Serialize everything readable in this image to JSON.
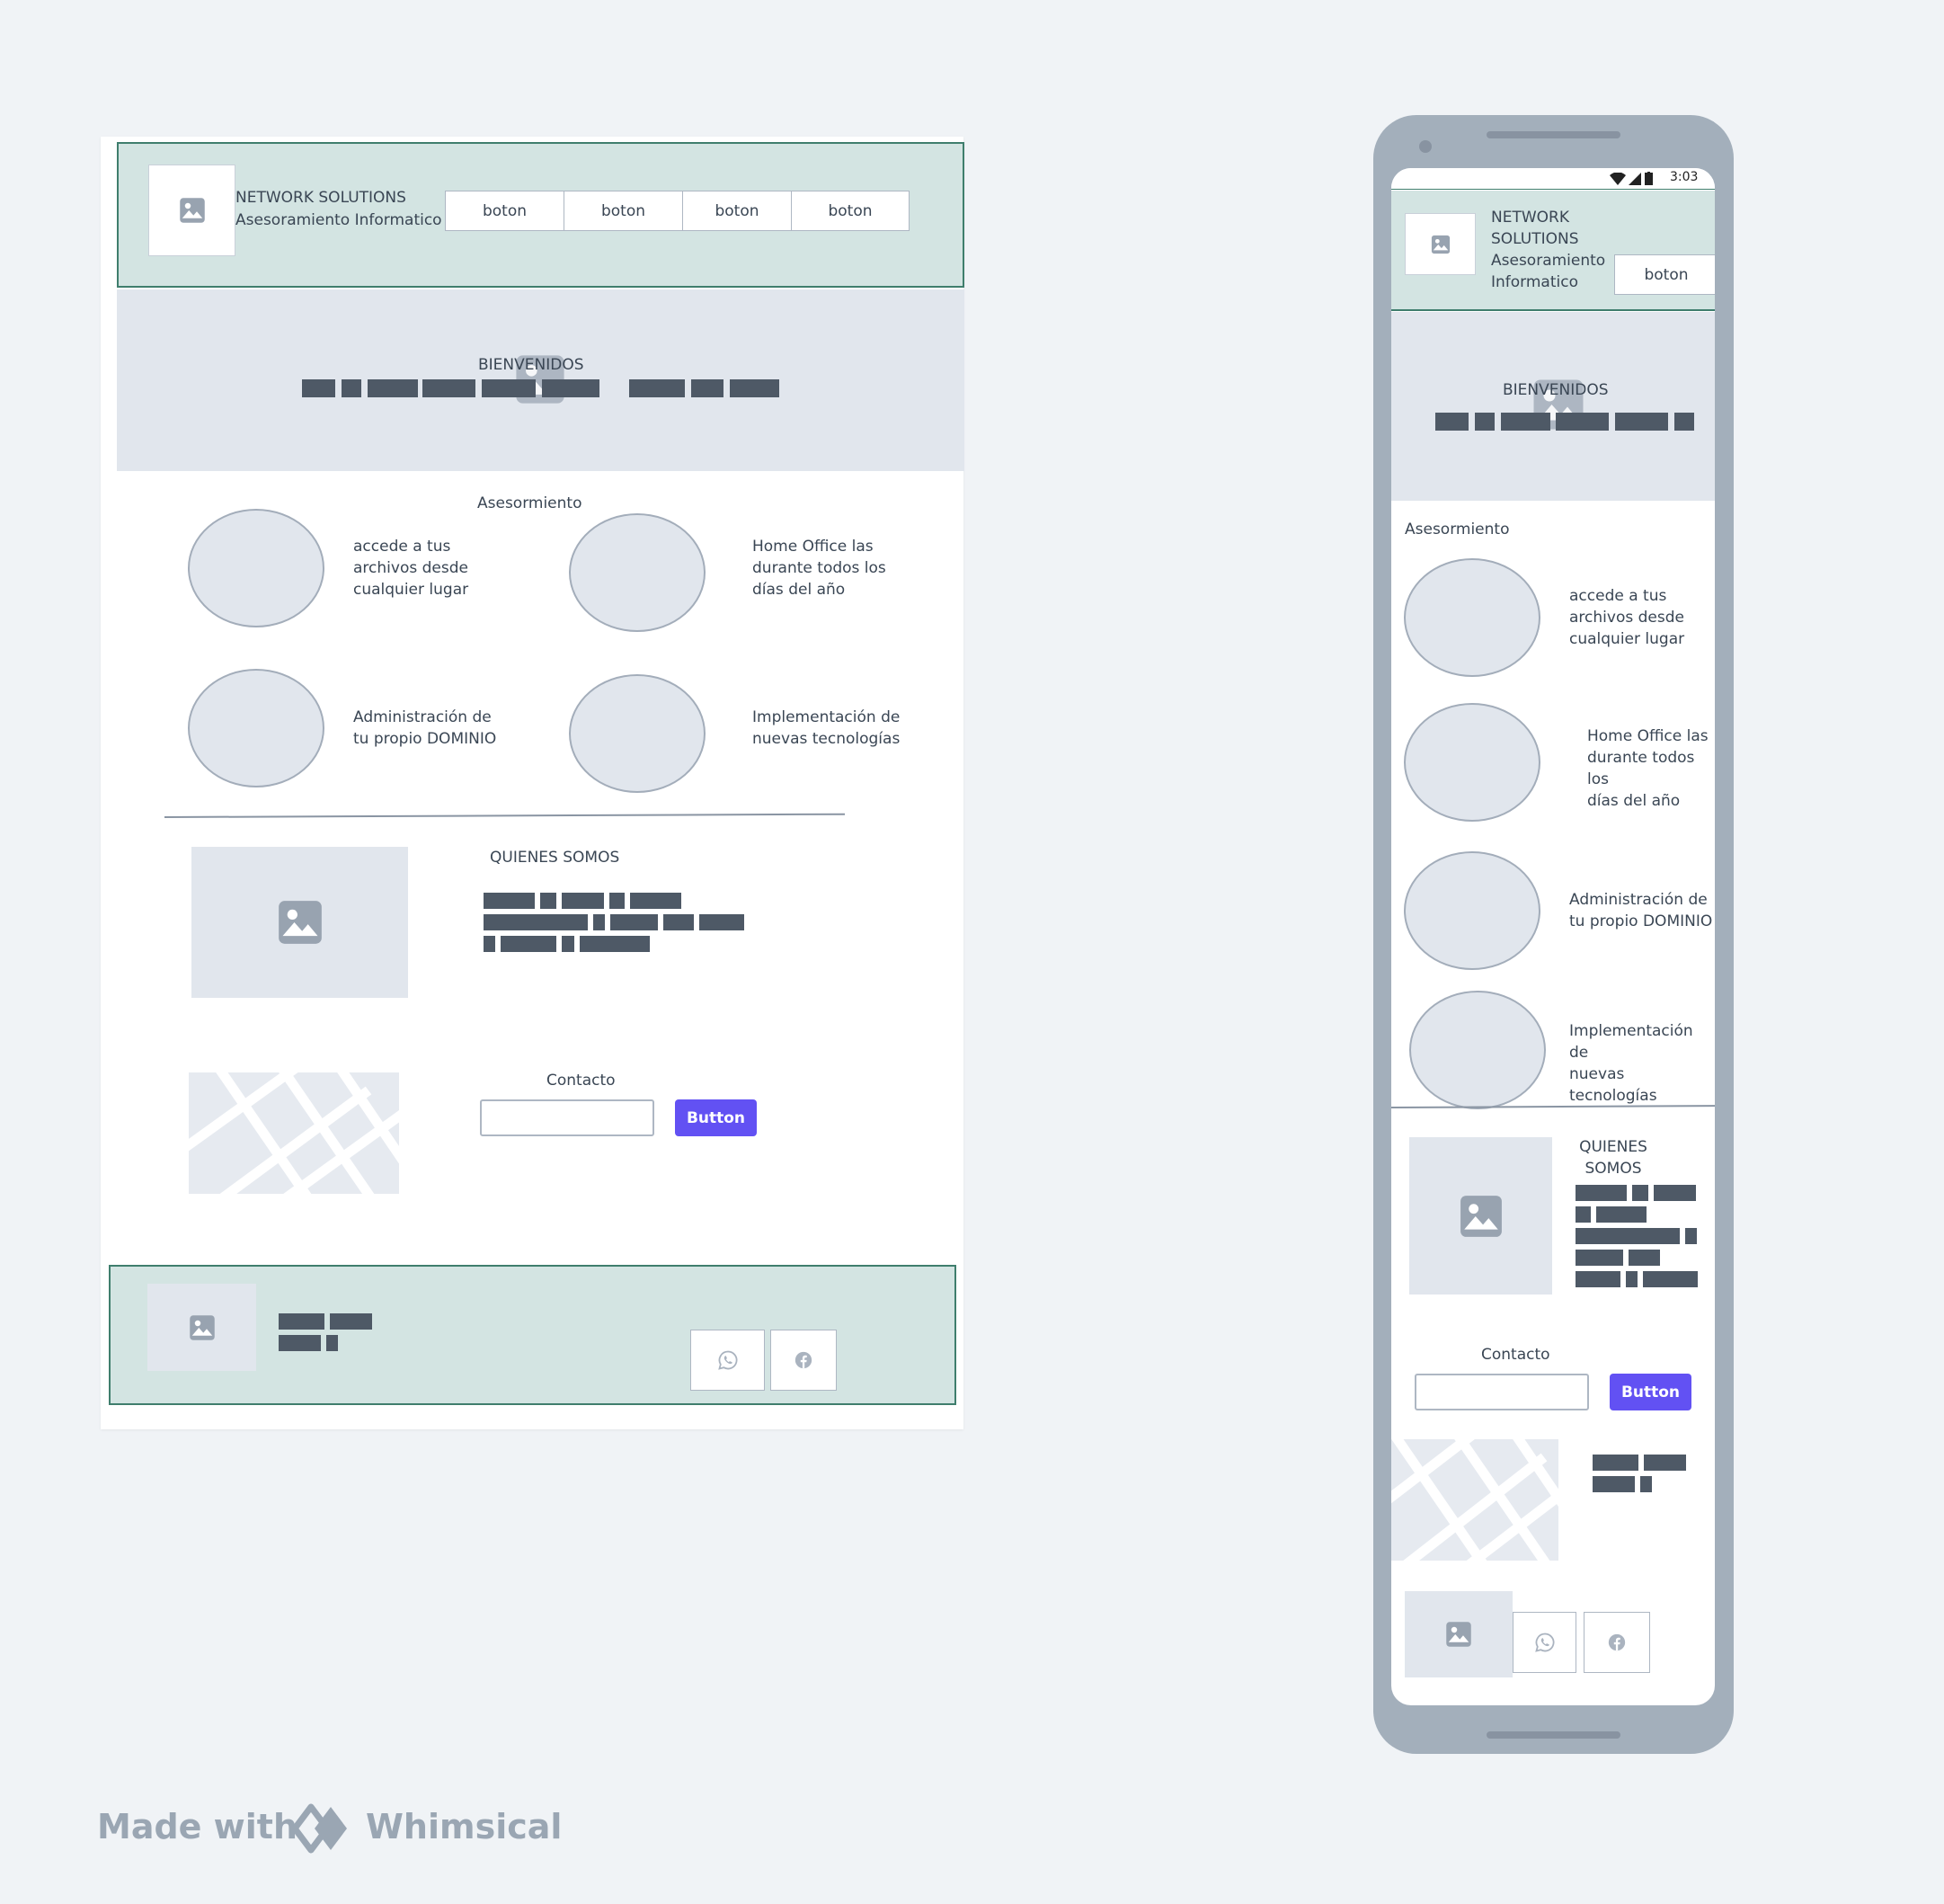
{
  "brand": {
    "line1": "NETWORK SOLUTIONS",
    "line2": "Asesoramiento Informatico",
    "mobile_lines": [
      "NETWORK",
      "SOLUTIONS",
      "Asesoramiento",
      "Informatico"
    ]
  },
  "nav": [
    "boton",
    "boton",
    "boton",
    "boton"
  ],
  "mobile_nav": "boton",
  "hero": {
    "title": "BIENVENIDOS"
  },
  "services": {
    "title": "Asesormiento",
    "items": [
      {
        "lines": [
          "accede a tus",
          "archivos desde",
          "cualquier lugar"
        ]
      },
      {
        "lines": [
          "Home Office las",
          "durante todos los",
          "días del año"
        ]
      },
      {
        "lines": [
          "Administración de",
          "tu propio DOMINIO"
        ]
      },
      {
        "lines": [
          "Implementación de",
          "nuevas tecnologías"
        ]
      }
    ]
  },
  "about": {
    "title": "QUIENES SOMOS",
    "mobile_lines": [
      "QUIENES",
      "SOMOS"
    ]
  },
  "contact": {
    "title": "Contacto",
    "button": "Button",
    "input_value": ""
  },
  "status_bar": {
    "time": "3:03"
  },
  "watermark": {
    "made_with": "Made with",
    "brand": "Whimsical"
  },
  "icons": [
    "image-icon",
    "whatsapp-icon",
    "facebook-icon",
    "wifi-icon",
    "signal-icon",
    "battery-icon"
  ],
  "colors": {
    "header_bg": "#d3e4e2",
    "header_border": "#3f7e6d",
    "placeholder": "#e1e6ed",
    "accent": "#6251f3",
    "text_block": "#4e5966",
    "phone": "#a3afbb"
  }
}
